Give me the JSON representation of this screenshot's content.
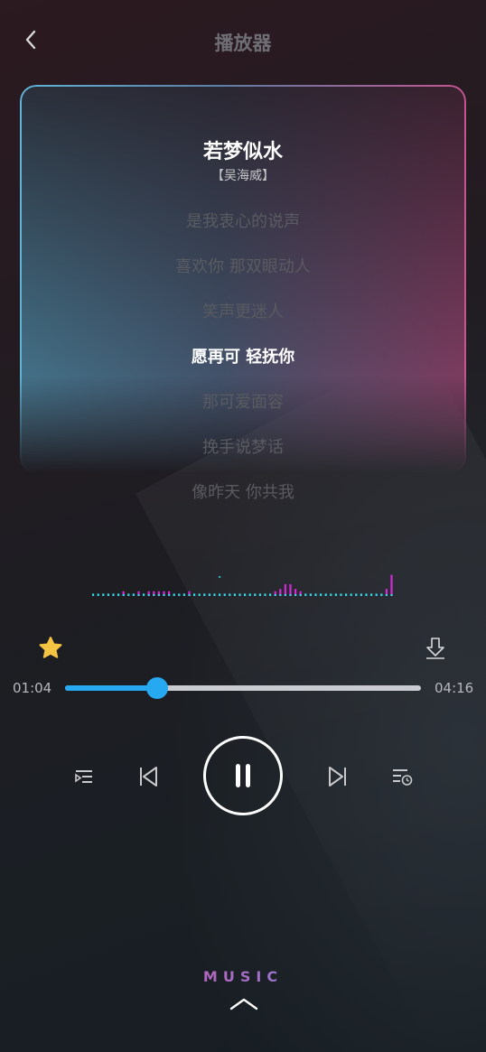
{
  "header": {
    "title": "播放器"
  },
  "song": {
    "title": "若梦似水",
    "singer": "【吴海威】"
  },
  "lyrics": {
    "lines": [
      "是我衷心的说声",
      "喜欢你 那双眼动人",
      "笑声更迷人",
      "愿再可 轻抚你",
      "那可爱面容",
      "挽手说梦话",
      "像昨天 你共我"
    ],
    "active_index": 3
  },
  "player": {
    "time_current": "01:04",
    "time_total": "04:16",
    "progress": 0.26,
    "favorited": true
  },
  "footer": {
    "brand": "MUSIC"
  },
  "icons": {
    "back": "chevron-left-icon",
    "favorite": "star-icon",
    "download": "download-icon",
    "playlist": "playlist-icon",
    "prev": "skip-previous-icon",
    "play_pause": "pause-icon",
    "next": "skip-next-icon",
    "history": "history-icon",
    "expand": "chevron-up-icon"
  },
  "colors": {
    "accent": "#27a9f1",
    "favorite": "#f6c443",
    "visualizer_cyan": "#38d6e8",
    "visualizer_magenta": "#d22ad6"
  },
  "visualizer": {
    "levels": [
      1,
      1,
      1,
      1,
      1,
      1,
      2,
      1,
      1,
      2,
      1,
      2,
      2,
      2,
      2,
      2,
      1,
      1,
      1,
      2,
      1,
      1,
      1,
      1,
      1,
      1,
      1,
      1,
      1,
      1,
      1,
      1,
      1,
      1,
      1,
      1,
      2,
      3,
      5,
      5,
      3,
      2,
      1,
      1,
      1,
      1,
      1,
      1,
      1,
      1,
      1,
      1,
      1,
      1,
      1,
      1,
      1,
      1,
      3,
      9
    ],
    "peaks": [
      0,
      0,
      0,
      0,
      0,
      0,
      0,
      0,
      0,
      0,
      0,
      0,
      0,
      0,
      0,
      0,
      0,
      0,
      0,
      0,
      0,
      0,
      0,
      0,
      0,
      14,
      0,
      0,
      0,
      0,
      0,
      0,
      0,
      0,
      0,
      0,
      0,
      0,
      0,
      0,
      0,
      0,
      0,
      0,
      0,
      0,
      0,
      0,
      0,
      0,
      0,
      0,
      0,
      0,
      0,
      0,
      0,
      0,
      0,
      0
    ]
  }
}
